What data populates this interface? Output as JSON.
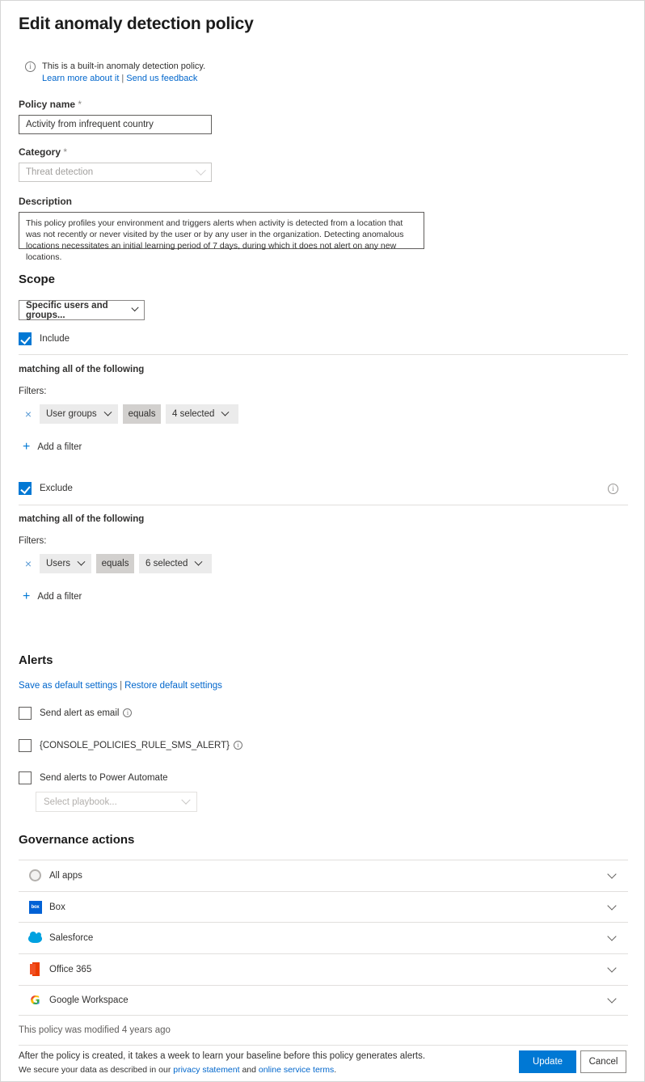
{
  "page": {
    "title": "Edit anomaly detection policy"
  },
  "builtin_note": {
    "icon": "info-icon",
    "text": "This is a built-in anomaly detection policy.",
    "learn_more_label": "Learn more about it",
    "divider": "|",
    "feedback_label": "Send us feedback"
  },
  "policy_name": {
    "label": "Policy name",
    "required_marker": "*",
    "value": "Activity from infrequent country"
  },
  "category": {
    "label": "Category",
    "required_marker": "*",
    "value": "Threat detection"
  },
  "description": {
    "label": "Description",
    "value": "This policy profiles your environment and triggers alerts when activity is detected from a location that was not recently or never visited by the user or by any user in the organization. Detecting anomalous locations necessitates an initial learning period of 7 days, during which it does not alert on any new locations."
  },
  "scope": {
    "heading": "Scope",
    "selector_value": "Specific users and groups...",
    "include": {
      "label": "Include",
      "checked": true,
      "matching_text": "matching all of the following",
      "filters_label": "Filters:",
      "filters": [
        {
          "remove": "×",
          "field": "User groups",
          "operator": "equals",
          "value": "4 selected"
        }
      ],
      "add_filter_label": "Add a filter"
    },
    "exclude": {
      "label": "Exclude",
      "checked": true,
      "info_icon": "info-icon",
      "matching_text": "matching all of the following",
      "filters_label": "Filters:",
      "filters": [
        {
          "remove": "×",
          "field": "Users",
          "operator": "equals",
          "value": "6 selected"
        }
      ],
      "add_filter_label": "Add a filter"
    }
  },
  "alerts": {
    "heading": "Alerts",
    "save_default_label": "Save as default settings",
    "divider": "|",
    "restore_default_label": "Restore default settings",
    "options": [
      {
        "label": "Send alert as email",
        "checked": false,
        "has_info": true
      },
      {
        "label": "{CONSOLE_POLICIES_RULE_SMS_ALERT}",
        "checked": false,
        "has_info": true
      },
      {
        "label": "Send alerts to Power Automate",
        "checked": false,
        "has_info": false
      }
    ],
    "playbook_placeholder": "Select playbook..."
  },
  "governance": {
    "heading": "Governance actions",
    "rows": [
      {
        "icon": "all-apps-icon",
        "name": "All apps"
      },
      {
        "icon": "box-icon",
        "name": "Box",
        "icon_text": "box"
      },
      {
        "icon": "salesforce-icon",
        "name": "Salesforce"
      },
      {
        "icon": "office365-icon",
        "name": "Office 365"
      },
      {
        "icon": "google-workspace-icon",
        "name": "Google Workspace",
        "icon_text": "G"
      }
    ]
  },
  "footer": {
    "modified_text": "This policy was modified 4 years ago",
    "note_line1": "After the policy is created, it takes a week to learn your baseline before this policy generates alerts.",
    "note_line2_prefix": "We secure your data as described in our ",
    "privacy_link": "privacy statement",
    "note_line2_mid": " and ",
    "terms_link": "online service terms",
    "note_line2_suffix": ".",
    "update_label": "Update",
    "cancel_label": "Cancel"
  },
  "colors": {
    "accent": "#0078d4",
    "link": "#0066cc",
    "pill": "#ebebeb",
    "pill_dark": "#d2d0ce"
  }
}
